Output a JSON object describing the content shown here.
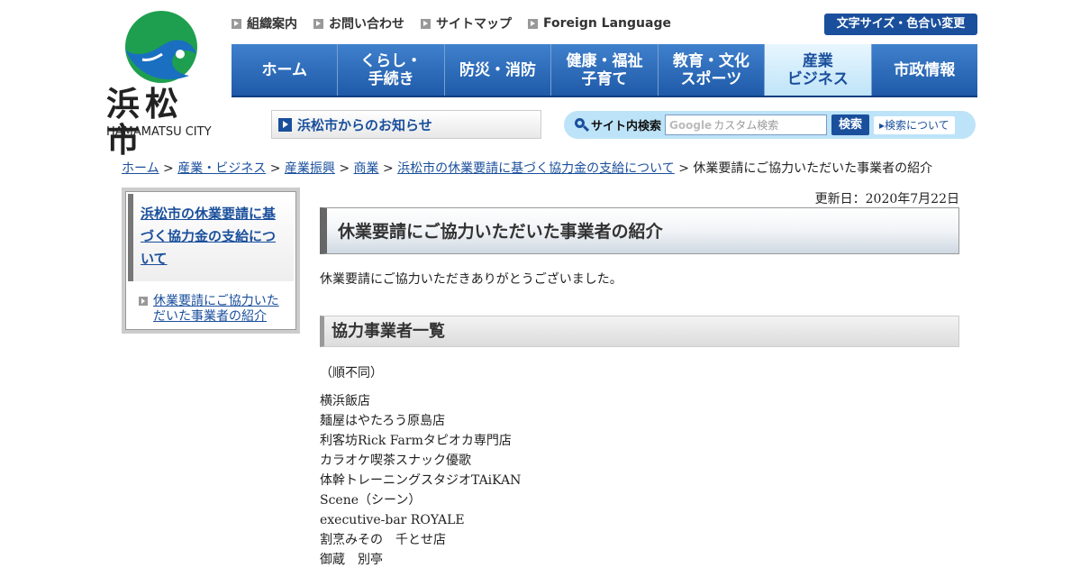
{
  "logo": {
    "text": "浜松市",
    "sub": "HAMAMATSU CITY",
    "colors": {
      "green": "#1e9f4f",
      "blue": "#1a6fc0"
    }
  },
  "utility_links": [
    "組織案内",
    "お問い合わせ",
    "サイトマップ",
    "Foreign Language"
  ],
  "font_size_button": "文字サイズ・色合い変更",
  "global_nav": [
    {
      "label": "ホーム"
    },
    {
      "label": "くらし・\n手続き"
    },
    {
      "label": "防災・消防"
    },
    {
      "label": "健康・福祉\n子育て"
    },
    {
      "label": "教育・文化\nスポーツ"
    },
    {
      "label": "産業\nビジネス",
      "active": true
    },
    {
      "label": "市政情報"
    }
  ],
  "notice_label": "浜松市からのお知らせ",
  "search": {
    "label": "サイト内検索",
    "google_mark": "Google",
    "placeholder": "カスタム検索",
    "button": "検索",
    "about": "検索について"
  },
  "breadcrumb": {
    "links": [
      "ホーム",
      "産業・ビジネス",
      "産業振興",
      "商業",
      "浜松市の休業要請に基づく協力金の支給について"
    ],
    "current": "休業要請にご協力いただいた事業者の紹介",
    "separator": ">"
  },
  "sidebar": {
    "title": "浜松市の休業要請に基づく協力金の支給について",
    "items": [
      "休業要請にご協力いただいた事業者の紹介"
    ]
  },
  "updated": "更新日：2020年7月22日",
  "page_title": "休業要請にご協力いただいた事業者の紹介",
  "intro": "休業要請にご協力いただきありがとうございました。",
  "section_title": "協力事業者一覧",
  "order_note": "（順不同）",
  "businesses": [
    "横浜飯店",
    "麺屋はやたろう原島店",
    "利客坊Rick Farmタピオカ専門店",
    "カラオケ喫茶スナック優歌",
    "体幹トレーニングスタジオTAiKAN",
    "Scene（シーン）",
    "executive-bar ROYALE",
    "割烹みその　千とせ店",
    "御蔵　別亭"
  ]
}
